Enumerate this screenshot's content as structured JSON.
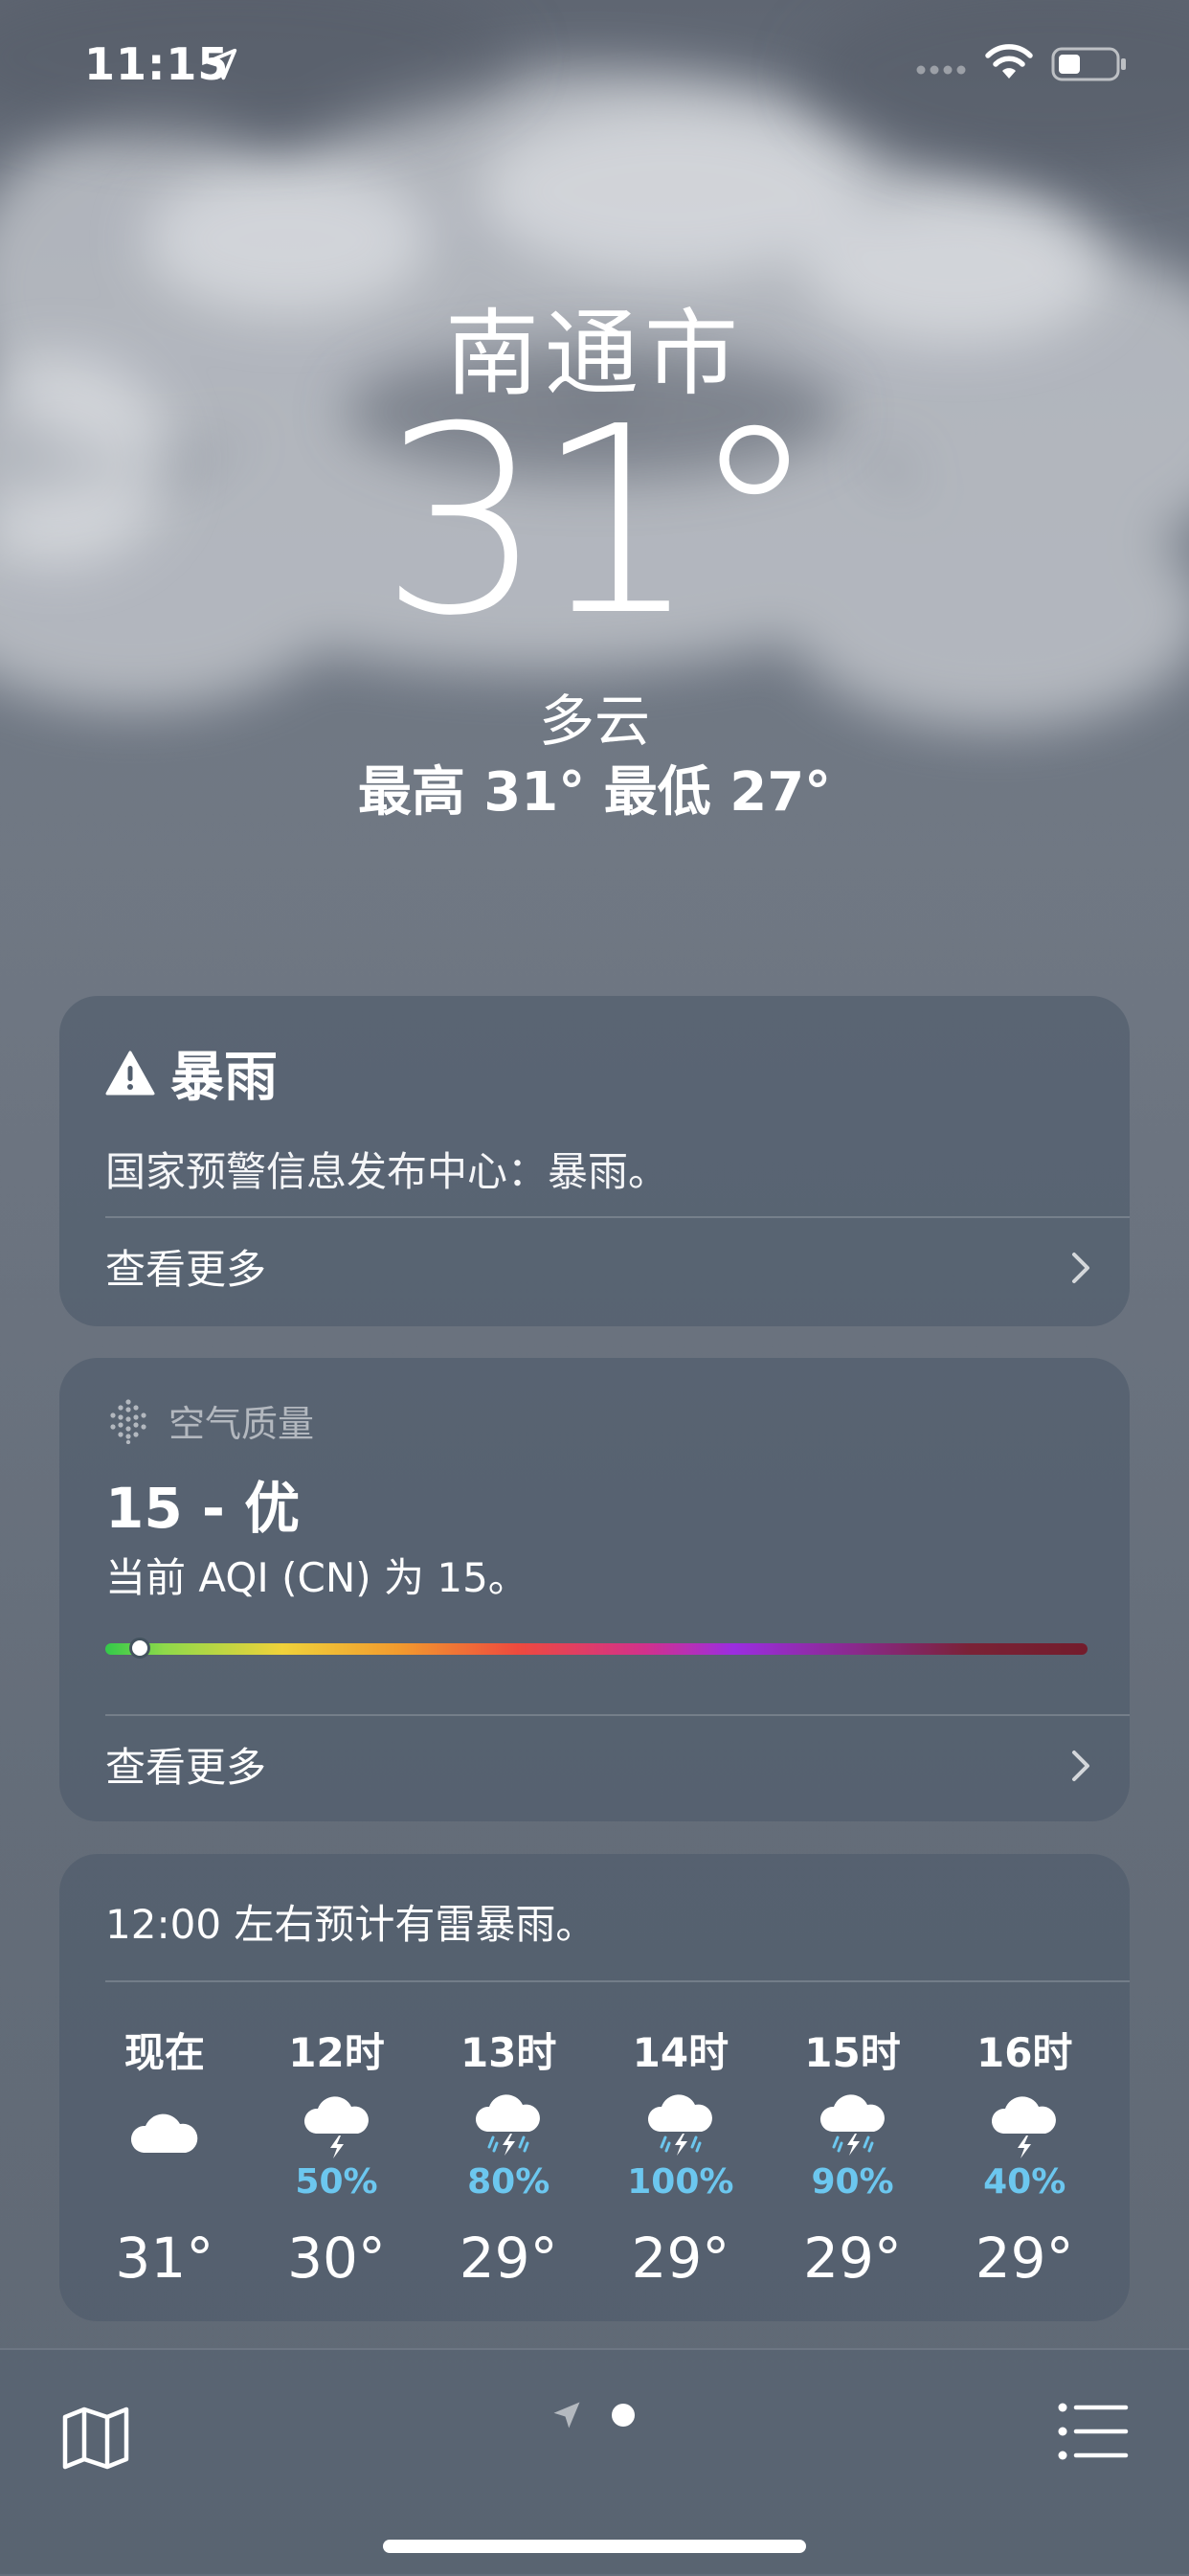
{
  "status_bar": {
    "time": "11:15",
    "icons": [
      "location-arrow-icon",
      "signal-icon",
      "wifi-icon",
      "battery-icon"
    ]
  },
  "location": {
    "city": "南通市",
    "temperature": "31°",
    "condition": "多云",
    "high_low": "最高 31°  最低 27°"
  },
  "alert_card": {
    "icon": "warning-triangle-icon",
    "title": "暴雨",
    "body": "国家预警信息发布中心：暴雨。",
    "more": "查看更多"
  },
  "air_quality_card": {
    "icon": "air-quality-icon",
    "header": "空气质量",
    "value": "15 - 优",
    "description": "当前 AQI (CN) 为 15。",
    "scale_position": 0.035,
    "more": "查看更多"
  },
  "hourly_card": {
    "summary": "12:00 左右预计有雷暴雨。",
    "hours": [
      {
        "label": "现在",
        "icon": "cloud-icon",
        "prob": "",
        "temp": "31°"
      },
      {
        "label": "12时",
        "icon": "thunderstorm-icon",
        "prob": "50%",
        "temp": "30°"
      },
      {
        "label": "13时",
        "icon": "thunderstorm-rain-icon",
        "prob": "80%",
        "temp": "29°"
      },
      {
        "label": "14时",
        "icon": "thunderstorm-rain-icon",
        "prob": "100%",
        "temp": "29°"
      },
      {
        "label": "15时",
        "icon": "thunderstorm-rain-icon",
        "prob": "90%",
        "temp": "29°"
      },
      {
        "label": "16时",
        "icon": "thunderstorm-icon",
        "prob": "40%",
        "temp": "29°"
      }
    ]
  },
  "bottom_bar": {
    "icons": [
      "map-icon",
      "current-location-page-icon",
      "page-dot",
      "list-icon"
    ]
  },
  "colors": {
    "precip": "#6cc7ef",
    "card_bg": "#4e5a6a"
  }
}
